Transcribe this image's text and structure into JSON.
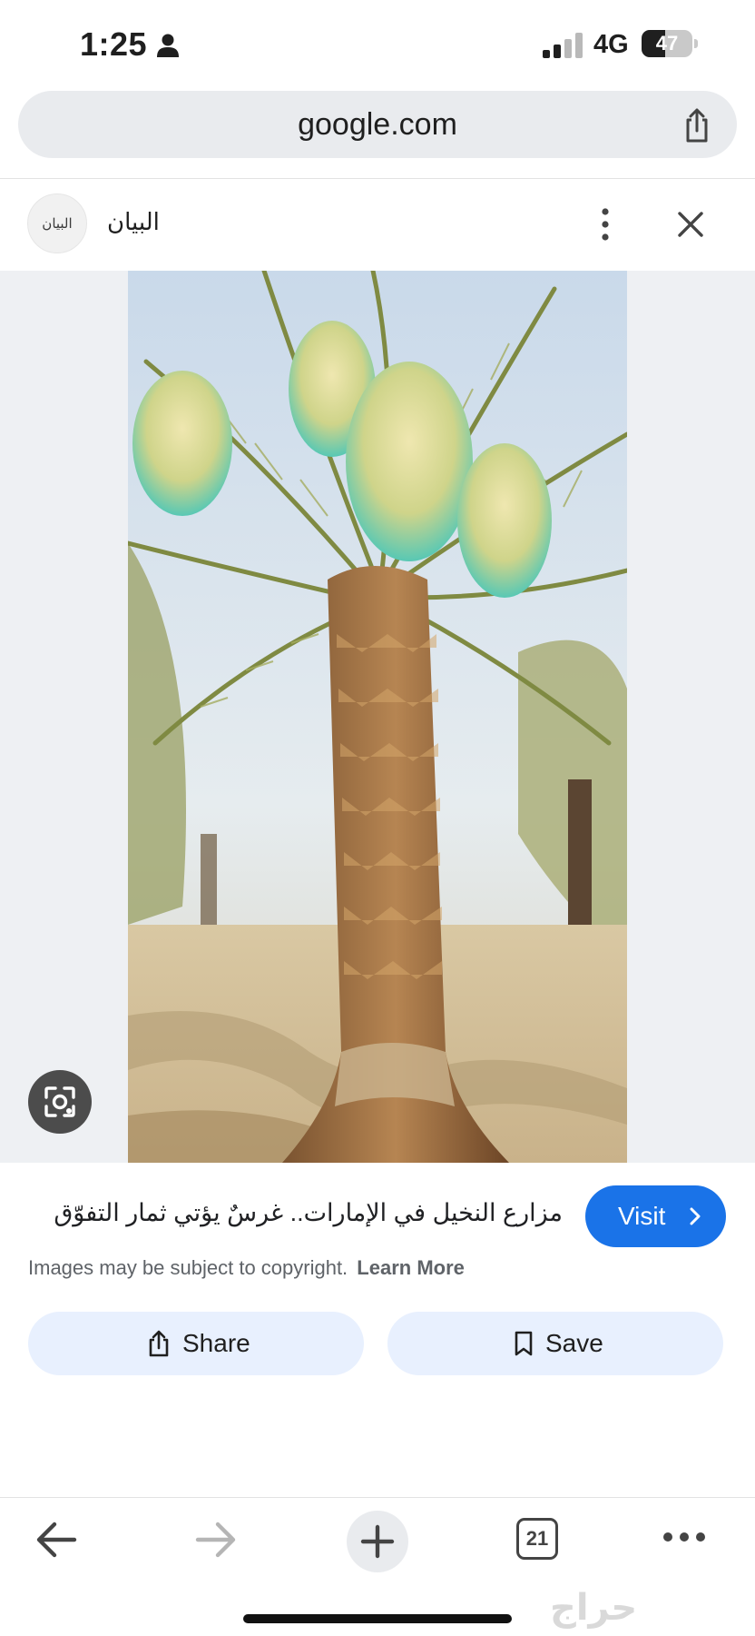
{
  "status_bar": {
    "time": "1:25",
    "network": "4G",
    "battery": "47",
    "battery_level": 0.47
  },
  "browser": {
    "url": "google.com"
  },
  "source": {
    "logo_text": "البيان",
    "name": "البيان"
  },
  "image_panel": {
    "caption": "مزارع النخيل في الإمارات.. غرسٌ يؤتي ثمار التفوّق",
    "visit_label": "Visit",
    "copyright_text": "Images may be subject to copyright.",
    "learn_more_label": "Learn More",
    "share_label": "Share",
    "save_label": "Save"
  },
  "toolbar": {
    "tab_count": "21",
    "watermark": "حراج"
  },
  "icons": [
    "person-icon",
    "signal-icon",
    "share-icon",
    "more-vert-icon",
    "close-icon",
    "lens-icon",
    "chevron-right-icon",
    "share-icon",
    "bookmark-icon",
    "back-arrow-icon",
    "forward-arrow-icon",
    "plus-icon",
    "tabs-icon",
    "more-horiz-icon"
  ],
  "colors": {
    "accent": "#1a73e8",
    "pill_bg": "#e8f0fe",
    "url_bar_bg": "#e9ebee"
  }
}
